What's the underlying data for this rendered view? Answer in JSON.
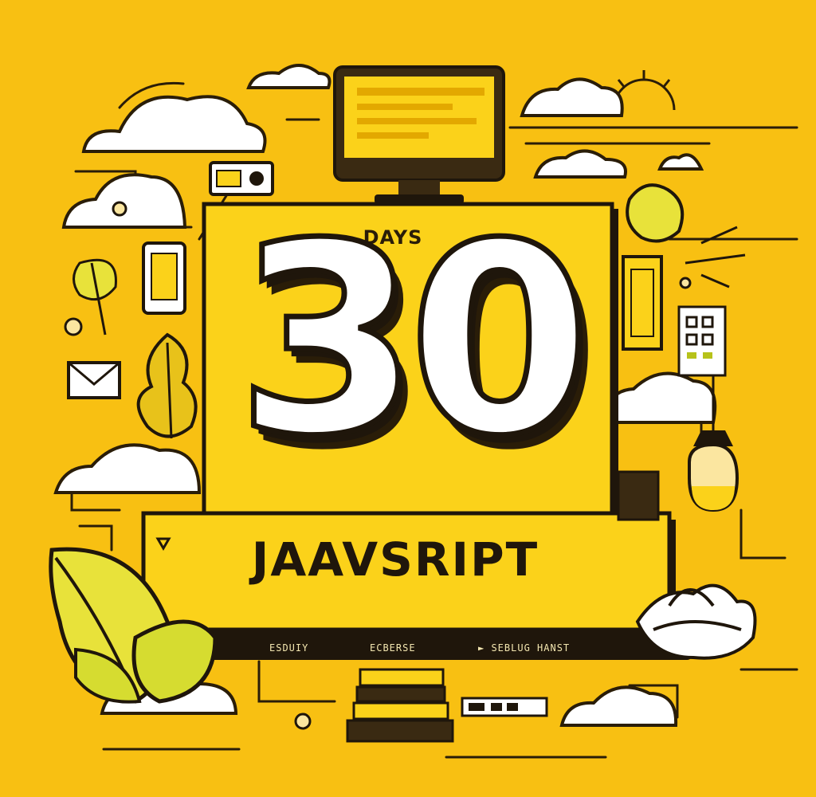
{
  "poster": {
    "days_label": "DAYS",
    "number": "30",
    "title": "JAAVSRIPT",
    "banner_items": [
      "ESDUIY",
      "ECBERSE",
      "► SEBLUG HANST"
    ]
  },
  "colors": {
    "background": "#F8C012",
    "panel": "#FBD21A",
    "ink": "#1F160B",
    "cloud": "#FFFFFF",
    "leaf": "#E8E23A"
  },
  "icons": [
    "monitor-icon",
    "camera-icon",
    "phone-icon",
    "envelope-icon",
    "lightbulb-icon",
    "lotus-icon",
    "leaf-icon",
    "cloud-icon",
    "sun-icon",
    "calendar-icon",
    "books-icon"
  ]
}
